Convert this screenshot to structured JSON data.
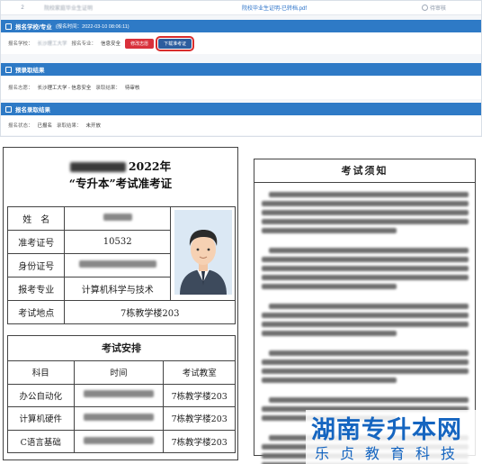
{
  "portal": {
    "file_row": {
      "index": "2",
      "doc_name": "院校家庭毕业生证明",
      "file": "院校毕业生证明-已转档.pdf",
      "status": "待审核"
    },
    "school_section": {
      "title": "报名学校/专业",
      "time": "(报名时间：2022-03-10 08:06:11)",
      "school_label": "报名学校：",
      "school_value": "长沙理工大学",
      "major_label": "报名专业：",
      "major_value": "信息安全",
      "modify_btn": "修改志愿",
      "download_btn": "下载准考证"
    },
    "pre_result_section": {
      "title": "预录取结果",
      "name_label": "报名志愿：",
      "name_value": "长沙理工大学 - 信息安全",
      "result_label": "录取结果：",
      "result_value": "待审核"
    },
    "result_section": {
      "title": "报名录取结果",
      "status_label": "报名状态：",
      "status_value": "已报名",
      "result_label": "录取结果：",
      "result_value": "未开放"
    }
  },
  "ticket": {
    "year_title": "2022年",
    "subtitle": "“专升本”考试准考证",
    "rows": [
      {
        "label": "姓　名",
        "value": ""
      },
      {
        "label": "准考证号",
        "value": "10532"
      },
      {
        "label": "身份证号",
        "value": ""
      },
      {
        "label": "报考专业",
        "value": "计算机科学与技术"
      }
    ],
    "location_label": "考试地点",
    "location_value": "7栋教学楼203",
    "schedule_title": "考试安排",
    "schedule_headers": [
      "科目",
      "时间",
      "考试教室"
    ],
    "schedule": [
      {
        "subject": "办公自动化",
        "room": "7栋教学楼203"
      },
      {
        "subject": "计算机硬件",
        "room": "7栋教学楼203"
      },
      {
        "subject": "C语言基础",
        "room": "7栋教学楼203"
      }
    ]
  },
  "notice": {
    "title": "考试须知"
  },
  "watermark": {
    "title": "湖南专升本网",
    "subtitle": "乐贞教育科技",
    "color": "#1565c0"
  },
  "colors": {
    "primary_blue": "#2e7ac6",
    "button_red": "#d9303b",
    "button_blue": "#2d5d9e",
    "highlight_red": "#d92d2d"
  }
}
